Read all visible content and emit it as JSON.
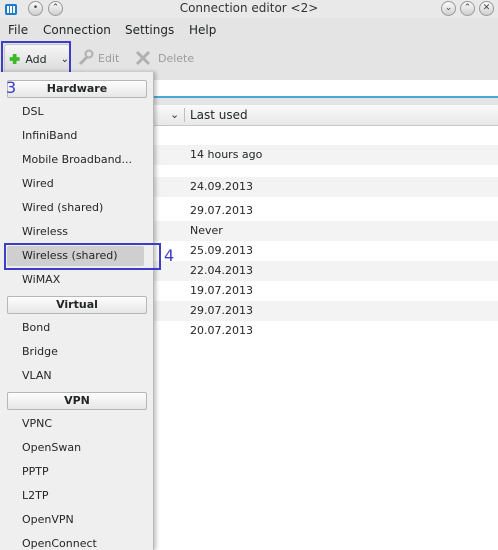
{
  "window": {
    "title": "Connection editor <2>"
  },
  "menubar": {
    "file": "File",
    "connection": "Connection",
    "settings": "Settings",
    "help": "Help"
  },
  "toolbar": {
    "add": "Add",
    "edit": "Edit",
    "delete": "Delete"
  },
  "table": {
    "header_last_used": "Last used",
    "rows": [
      "",
      "14 hours ago",
      "",
      "24.09.2013",
      "29.07.2013",
      "Never",
      "25.09.2013",
      "22.04.2013",
      "19.07.2013",
      "29.07.2013",
      "20.07.2013"
    ]
  },
  "dropdown": {
    "hardware": "Hardware",
    "hardware_items": [
      "DSL",
      "InfiniBand",
      "Mobile Broadband...",
      "Wired",
      "Wired (shared)",
      "Wireless",
      "Wireless (shared)",
      "WiMAX"
    ],
    "virtual": "Virtual",
    "virtual_items": [
      "Bond",
      "Bridge",
      "VLAN"
    ],
    "vpn": "VPN",
    "vpn_items": [
      "VPNC",
      "OpenSwan",
      "PPTP",
      "L2TP",
      "OpenVPN",
      "OpenConnect"
    ]
  },
  "annotations": {
    "step3": "3",
    "step4": "4"
  },
  "colors": {
    "annotation": "#3d3dc8",
    "search_accent": "#4aa8d8",
    "add_icon": "#3cba2a"
  }
}
